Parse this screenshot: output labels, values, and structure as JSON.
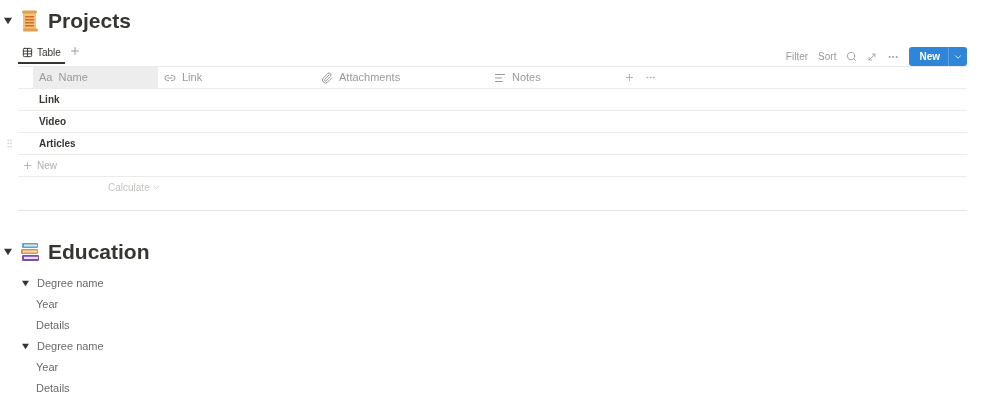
{
  "projects": {
    "title": "Projects",
    "expanded": true,
    "views": [
      {
        "label": "Table",
        "selected": true
      }
    ],
    "toolbar": {
      "filter": "Filter",
      "sort": "Sort",
      "new_button": "New"
    },
    "columns": [
      {
        "kind": "title",
        "prefix": "Aa",
        "label": "Name"
      },
      {
        "kind": "url",
        "label": "Link"
      },
      {
        "kind": "files",
        "label": "Attachments"
      },
      {
        "kind": "text",
        "label": "Notes"
      }
    ],
    "rows": [
      {
        "name": "Link"
      },
      {
        "name": "Video"
      },
      {
        "name": "Articles"
      }
    ],
    "new_row": "New",
    "calculate": "Calculate"
  },
  "education": {
    "title": "Education",
    "expanded": true,
    "items": [
      {
        "label": "Degree name",
        "expanded": true,
        "children": [
          {
            "label": "Year"
          },
          {
            "label": "Details"
          }
        ]
      },
      {
        "label": "Degree name",
        "expanded": true,
        "children": [
          {
            "label": "Year"
          },
          {
            "label": "Details"
          }
        ]
      }
    ]
  }
}
